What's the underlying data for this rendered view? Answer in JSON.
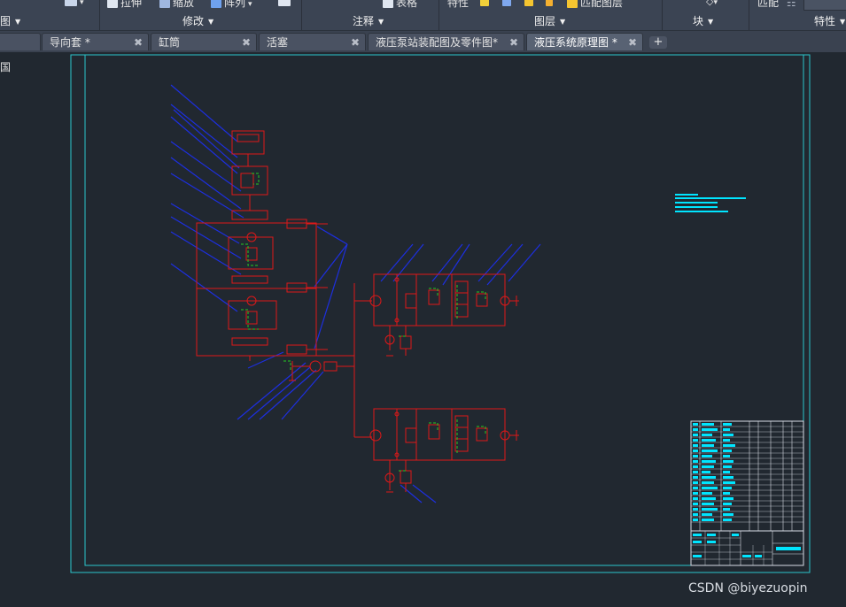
{
  "ribbon": {
    "top_items": [
      {
        "label": "拉伸",
        "icon": "stretch-icon"
      },
      {
        "label": "缩放",
        "icon": "scale-icon"
      },
      {
        "label": "阵列",
        "icon": "array-icon"
      },
      {
        "label": "表格",
        "icon": "table-icon"
      },
      {
        "label": "特性",
        "icon": "properties-icon"
      },
      {
        "label": "匹配图层",
        "icon": "match-layer-icon"
      },
      {
        "label": "匹配",
        "icon": "match-icon"
      }
    ],
    "panels": [
      {
        "label": "图"
      },
      {
        "label": "修改"
      },
      {
        "label": "注释"
      },
      {
        "label": "图层"
      },
      {
        "label": "块"
      },
      {
        "label": "特性"
      }
    ]
  },
  "tabs": [
    {
      "label": "导向套 *",
      "active": false
    },
    {
      "label": "缸筒",
      "active": false
    },
    {
      "label": "活塞",
      "active": false
    },
    {
      "label": "液压泵站装配图及零件图*",
      "active": false
    },
    {
      "label": "液压系统原理图 *",
      "active": true
    }
  ],
  "tab_add_label": "+",
  "left_panel_text": "国",
  "watermark": "CSDN @biyezuopin",
  "colors": {
    "ribbon_bg": "#3b4453",
    "tab_bg": "#4a5262",
    "tab_active_bg": "#586273",
    "canvas_bg": "#212830",
    "frame": "#2cc6cc",
    "schematic_red": "#e01818",
    "leader_blue": "#1d2fe0",
    "valve_green": "#22cc22",
    "text_cyan": "#00e5ff",
    "title_block": "#d8dde6"
  }
}
